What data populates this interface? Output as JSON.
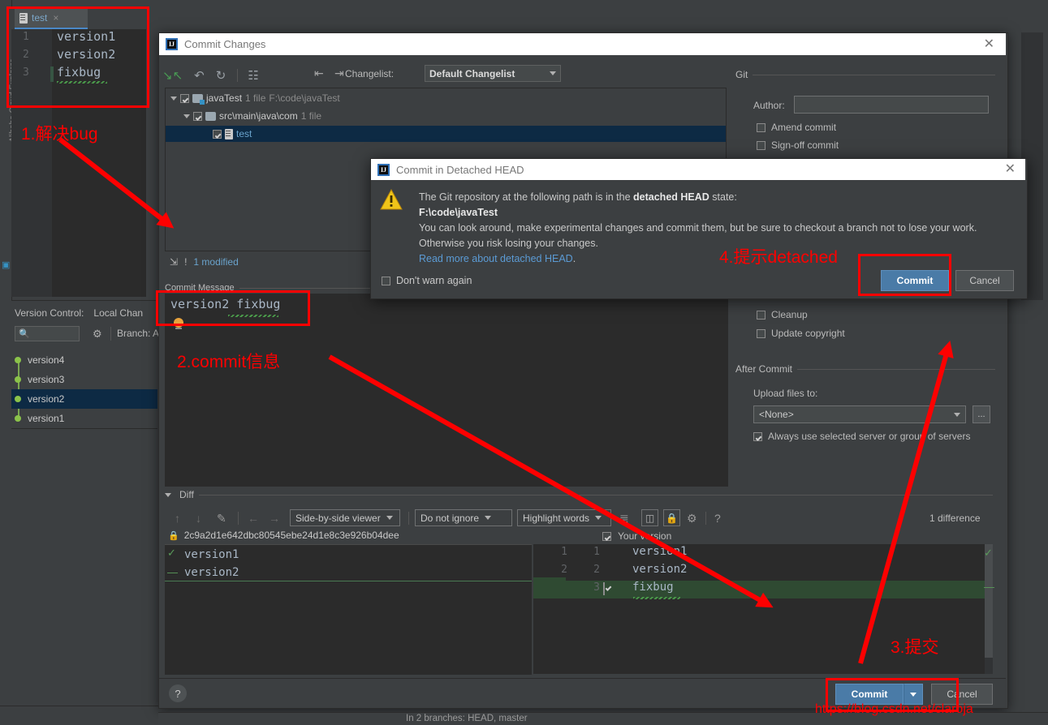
{
  "ide": {
    "left_tool_label": "Alibaba Cloud Explorer",
    "editor_tab": {
      "label": "test",
      "close": "×"
    },
    "editor": {
      "line_numbers": [
        "1",
        "2",
        "3"
      ],
      "lines": [
        "version1",
        "version2",
        "fixbug"
      ]
    },
    "status_bar": "In 2 branches: HEAD, master"
  },
  "version_control": {
    "title": "Version Control:",
    "tab": "Local Chan",
    "search_placeholder": "",
    "search_icon": "search-icon",
    "gear_icon": "gear-icon",
    "branch_label": "Branch: A",
    "commits": [
      {
        "label": "version4",
        "selected": false
      },
      {
        "label": "version3",
        "selected": false
      },
      {
        "label": "version2",
        "selected": true
      },
      {
        "label": "version1",
        "selected": false
      }
    ]
  },
  "commit_dialog": {
    "title": "Commit Changes",
    "close": "✕",
    "toolbar": {
      "icons": [
        "collapse-all-icon",
        "undo-icon",
        "refresh-icon",
        "group-by-icon"
      ],
      "expand_icon": "expand-all-icon",
      "collapse_icon": "collapse-all-icon"
    },
    "changelist_label": "Changelist:",
    "changelist_value": "Default Changelist",
    "file_tree": [
      {
        "name": "javaTest",
        "meta": "1 file",
        "path": "F:\\code\\javaTest",
        "checked": true,
        "expanded": true,
        "depth": 0,
        "kind": "folder",
        "selected": false
      },
      {
        "name": "src\\main\\java\\com",
        "meta": "1 file",
        "path": "",
        "checked": true,
        "expanded": true,
        "depth": 1,
        "kind": "folder",
        "selected": false
      },
      {
        "name": "test",
        "meta": "",
        "path": "",
        "checked": true,
        "expanded": false,
        "depth": 2,
        "kind": "file",
        "selected": true
      }
    ],
    "modified_status": "1 modified",
    "commit_message_legend": "Commit Message",
    "commit_message_value": "version2 fixbug",
    "git_section": {
      "legend": "Git",
      "author_label": "Author:",
      "author_value": "",
      "options": [
        {
          "label": "Amend commit",
          "checked": false
        },
        {
          "label": "Sign-off commit",
          "checked": false
        },
        {
          "label": "Cleanup",
          "checked": false
        },
        {
          "label": "Update copyright",
          "checked": false
        }
      ]
    },
    "after_commit": {
      "legend": "After Commit",
      "upload_label": "Upload files to:",
      "upload_value": "<None>",
      "browse_label": "...",
      "always_use_label": "Always use selected server or group of servers",
      "always_use_checked": true
    },
    "diff": {
      "legend": "Diff",
      "viewer_mode": "Side-by-side viewer",
      "ignore_mode": "Do not ignore",
      "highlight_mode": "Highlight words",
      "difference_count": "1 difference",
      "revision_hash": "2c9a2d1e642dbc80545ebe24d1e8c3e926b04dee",
      "your_version_label": "Your version",
      "your_version_checked": true,
      "left_lines": [
        "version1",
        "version2"
      ],
      "right_lines": [
        {
          "old": "1",
          "new": "1",
          "text": "version1",
          "added": false,
          "checked": false
        },
        {
          "old": "2",
          "new": "2",
          "text": "version2",
          "added": false,
          "checked": false
        },
        {
          "old": "",
          "new": "3",
          "text": "fixbug",
          "added": true,
          "checked": true
        }
      ],
      "help_icon": "?",
      "lock_icon": "lock-icon",
      "settings_icon": "gear-icon"
    },
    "buttons": {
      "help": "?",
      "commit": "Commit",
      "commit_dropdown": "▼",
      "cancel": "Cancel"
    }
  },
  "detached_dialog": {
    "title": "Commit in Detached HEAD",
    "close": "✕",
    "warning_icon": "warning-icon",
    "line1_a": "The Git repository at the following path is in the ",
    "line1_b": "detached HEAD",
    "line1_c": " state:",
    "path": "F:\\code\\javaTest",
    "line3": "You can look around, make experimental changes and commit them, but be sure to checkout a branch not to lose your work.",
    "line4": "Otherwise you risk losing your changes.",
    "link": "Read more about detached HEAD",
    "link_period": ".",
    "dont_warn_label": "Don't warn again",
    "dont_warn_checked": false,
    "commit_button": "Commit",
    "cancel_button": "Cancel"
  },
  "annotations": {
    "a1": "1.解决bug",
    "a2": "2.commit信息",
    "a3": "3.提交",
    "a4": "4.提示detached",
    "watermark": "https://blog.csdn.net/claroja"
  },
  "colors": {
    "accent_blue": "#4a7ba7",
    "annotation_red": "#fe0000",
    "added_green": "#2f4a32",
    "link_blue": "#5b9bd5",
    "panel_bg": "#3c3f41",
    "editor_bg": "#2b2b2b"
  }
}
